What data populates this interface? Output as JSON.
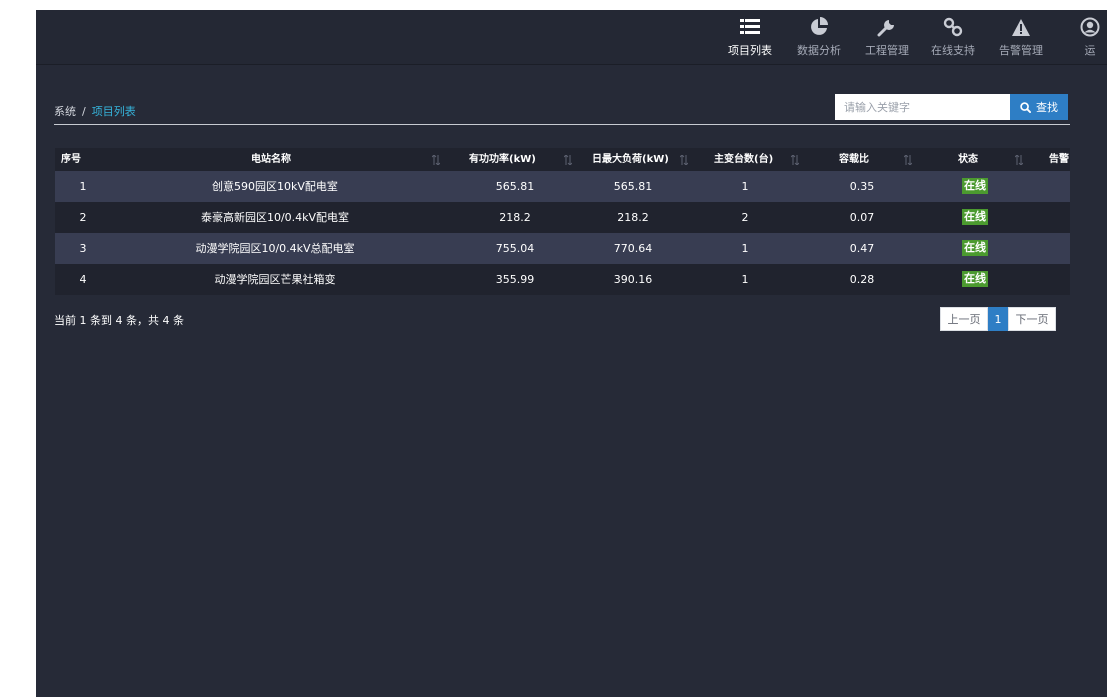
{
  "nav": {
    "items": [
      {
        "label": "项目列表",
        "icon": "list-icon",
        "active": true
      },
      {
        "label": "数据分析",
        "icon": "pie-chart-icon",
        "active": false
      },
      {
        "label": "工程管理",
        "icon": "wrench-icon",
        "active": false
      },
      {
        "label": "在线支持",
        "icon": "link-icon",
        "active": false
      },
      {
        "label": "告警管理",
        "icon": "warning-icon",
        "active": false
      },
      {
        "label": "运",
        "icon": "user-icon",
        "active": false
      }
    ]
  },
  "breadcrumb": {
    "root": "系统",
    "separator": "/",
    "current": "项目列表"
  },
  "search": {
    "placeholder": "请输入关键字",
    "button_label": "查找"
  },
  "table": {
    "headers": [
      "序号",
      "电站名称",
      "有功功率(kW)",
      "日最大负荷(kW)",
      "主变台数(台)",
      "容载比",
      "状态",
      "告警"
    ],
    "rows": [
      [
        "1",
        "创意590园区10kV配电室",
        "565.81",
        "565.81",
        "1",
        "0.35",
        "在线",
        ""
      ],
      [
        "2",
        "泰豪高新园区10/0.4kV配电室",
        "218.2",
        "218.2",
        "2",
        "0.07",
        "在线",
        ""
      ],
      [
        "3",
        "动漫学院园区10/0.4kV总配电室",
        "755.04",
        "770.64",
        "1",
        "0.47",
        "在线",
        ""
      ],
      [
        "4",
        "动漫学院园区芒果社箱变",
        "355.99",
        "390.16",
        "1",
        "0.28",
        "在线",
        ""
      ]
    ]
  },
  "summary": "当前 1 条到 4 条，共 4 条",
  "pagination": {
    "prev": "上一页",
    "current": "1",
    "next": "下一页"
  },
  "colors": {
    "accent": "#2e7ec5",
    "breadcrumb_active": "#36b5dd",
    "status_online": "#4b9a2f",
    "background": "#262a37"
  }
}
